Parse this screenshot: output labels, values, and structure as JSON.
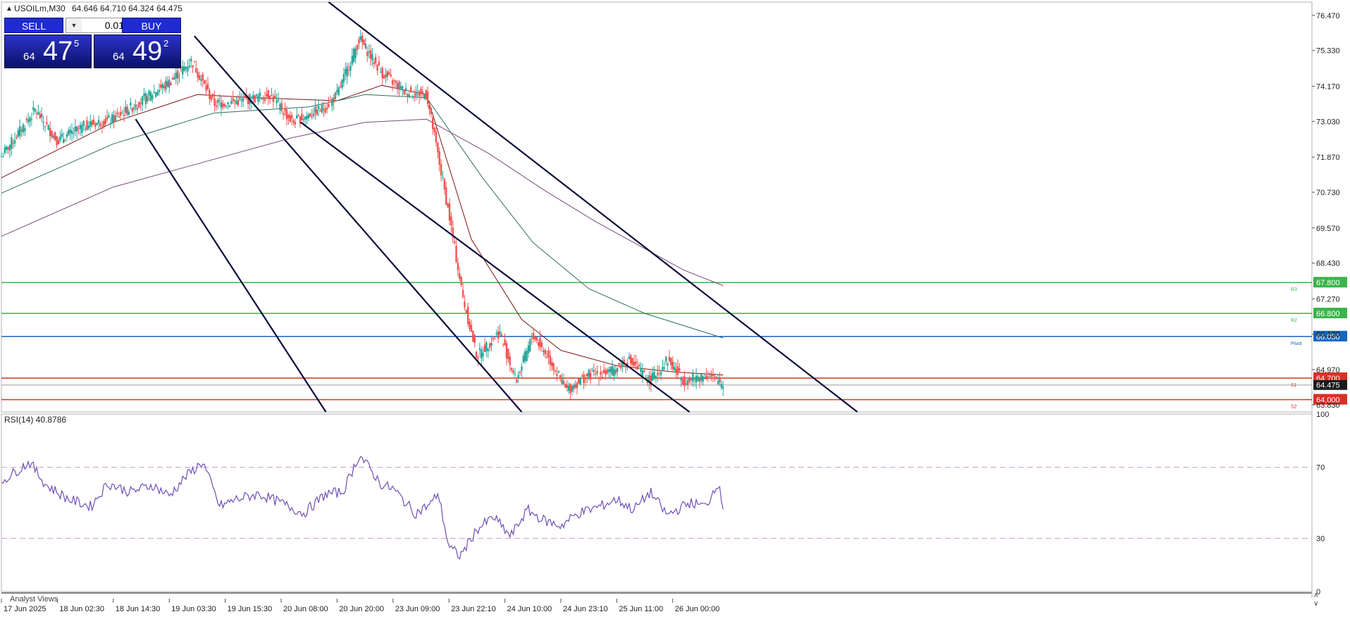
{
  "header": {
    "symbol": "USOILm,M30",
    "ohlc": "64.646 64.710 64.324 64.475"
  },
  "one_click": {
    "sell_label": "SELL",
    "buy_label": "BUY",
    "volume": "0.01",
    "sell_price": {
      "prefix": "64",
      "big": "47",
      "sup": "5"
    },
    "buy_price": {
      "prefix": "64",
      "big": "49",
      "sup": "2"
    }
  },
  "price_axis": {
    "ticks": [
      "76.470",
      "75.330",
      "74.170",
      "73.030",
      "71.870",
      "70.730",
      "69.570",
      "68.430",
      "67.270",
      "66.120",
      "64.970",
      "63.830"
    ],
    "last_price": "64.475"
  },
  "levels": [
    {
      "label": "R3",
      "price": "67.800",
      "value": 67.8,
      "color": "#3cb44b"
    },
    {
      "label": "R2",
      "price": "66.800",
      "value": 66.8,
      "color": "#3cb44b"
    },
    {
      "label": "Pivot",
      "price": "66.050",
      "value": 66.05,
      "color": "#1565c0"
    },
    {
      "label": "S1",
      "price": "64.700",
      "value": 64.7,
      "color": "#d93025"
    },
    {
      "label": "S2",
      "price": "64.000",
      "value": 64.0,
      "color": "#d93025"
    }
  ],
  "rsi": {
    "label": "RSI(14) 40.8786",
    "ticks": [
      "100",
      "70",
      "30",
      "0"
    ]
  },
  "time_axis": [
    "17 Jun 2025",
    "18 Jun 02:30",
    "18 Jun 14:30",
    "19 Jun 03:30",
    "19 Jun 15:30",
    "20 Jun 08:00",
    "20 Jun 20:00",
    "23 Jun 09:00",
    "23 Jun 22:10",
    "24 Jun 10:00",
    "24 Jun 23:10",
    "25 Jun 11:00",
    "26 Jun 00:00"
  ],
  "footer": {
    "analyst_views": "Analyst Views"
  },
  "colors": {
    "bull": "#26a69a",
    "bear": "#ef5350",
    "channel": "#0b0b3b",
    "rsi_line": "#6f4fb5",
    "ma_fast": "#7b1616",
    "ma_mid": "#2f6f5e",
    "ma_slow": "#7a4a7a"
  },
  "chart_data": {
    "type": "candlestick",
    "symbol": "USOILm",
    "timeframe": "M30",
    "ohlc_last": {
      "open": 64.646,
      "high": 64.71,
      "low": 64.324,
      "close": 64.475
    },
    "ylim": [
      63.6,
      76.9
    ],
    "close_path": [
      [
        0,
        71.9
      ],
      [
        0.6,
        73.4
      ],
      [
        1.0,
        72.4
      ],
      [
        1.5,
        72.9
      ],
      [
        2.0,
        73.1
      ],
      [
        2.5,
        73.7
      ],
      [
        3.0,
        74.3
      ],
      [
        3.4,
        75.0
      ],
      [
        3.8,
        73.6
      ],
      [
        4.3,
        73.7
      ],
      [
        4.8,
        73.9
      ],
      [
        5.2,
        73.0
      ],
      [
        5.8,
        73.5
      ],
      [
        6.0,
        73.9
      ],
      [
        6.4,
        75.7
      ],
      [
        6.8,
        74.6
      ],
      [
        7.2,
        74.0
      ],
      [
        7.6,
        73.9
      ],
      [
        8.0,
        70.0
      ],
      [
        8.25,
        67.3
      ],
      [
        8.5,
        65.4
      ],
      [
        8.9,
        66.2
      ],
      [
        9.2,
        64.6
      ],
      [
        9.5,
        66.1
      ],
      [
        9.8,
        65.3
      ],
      [
        10.1,
        64.3
      ],
      [
        10.5,
        64.8
      ],
      [
        10.9,
        64.9
      ],
      [
        11.2,
        65.3
      ],
      [
        11.6,
        64.6
      ],
      [
        11.9,
        65.3
      ],
      [
        12.2,
        64.6
      ],
      [
        12.6,
        64.8
      ],
      [
        12.9,
        64.5
      ]
    ],
    "rsi_path": [
      [
        0,
        62
      ],
      [
        0.5,
        73
      ],
      [
        0.8,
        60
      ],
      [
        1.2,
        52
      ],
      [
        1.6,
        48
      ],
      [
        1.9,
        61
      ],
      [
        2.3,
        56
      ],
      [
        2.7,
        60
      ],
      [
        3.0,
        54
      ],
      [
        3.3,
        65
      ],
      [
        3.6,
        73
      ],
      [
        3.9,
        48
      ],
      [
        4.2,
        52
      ],
      [
        4.6,
        55
      ],
      [
        5.0,
        50
      ],
      [
        5.4,
        44
      ],
      [
        5.8,
        55
      ],
      [
        6.1,
        56
      ],
      [
        6.4,
        77
      ],
      [
        6.8,
        60
      ],
      [
        7.0,
        58
      ],
      [
        7.4,
        44
      ],
      [
        7.7,
        50
      ],
      [
        7.8,
        56
      ],
      [
        8.0,
        25
      ],
      [
        8.2,
        20
      ],
      [
        8.5,
        35
      ],
      [
        8.8,
        42
      ],
      [
        9.1,
        31
      ],
      [
        9.4,
        46
      ],
      [
        9.7,
        40
      ],
      [
        10.0,
        37
      ],
      [
        10.3,
        44
      ],
      [
        10.7,
        48
      ],
      [
        11.0,
        52
      ],
      [
        11.3,
        46
      ],
      [
        11.6,
        56
      ],
      [
        11.9,
        43
      ],
      [
        12.3,
        50
      ],
      [
        12.6,
        48
      ],
      [
        12.8,
        62
      ],
      [
        12.95,
        41
      ]
    ],
    "ma_fast": [
      [
        0,
        71.2
      ],
      [
        2.0,
        73.0
      ],
      [
        3.5,
        73.9
      ],
      [
        4.5,
        73.8
      ],
      [
        6.0,
        73.7
      ],
      [
        6.8,
        74.2
      ],
      [
        7.6,
        73.9
      ],
      [
        8.4,
        69.2
      ],
      [
        9.3,
        66.6
      ],
      [
        10.0,
        65.6
      ],
      [
        11.0,
        65.1
      ],
      [
        12.0,
        64.9
      ],
      [
        12.9,
        64.8
      ]
    ],
    "ma_mid": [
      [
        0,
        70.7
      ],
      [
        2.0,
        72.3
      ],
      [
        3.8,
        73.3
      ],
      [
        5.5,
        73.5
      ],
      [
        6.5,
        73.9
      ],
      [
        7.6,
        73.8
      ],
      [
        8.6,
        71.2
      ],
      [
        9.5,
        69.1
      ],
      [
        10.5,
        67.6
      ],
      [
        11.5,
        66.8
      ],
      [
        12.9,
        66.0
      ]
    ],
    "ma_slow": [
      [
        0,
        69.3
      ],
      [
        2.0,
        70.9
      ],
      [
        3.8,
        71.8
      ],
      [
        5.2,
        72.5
      ],
      [
        6.5,
        73.0
      ],
      [
        7.6,
        73.1
      ],
      [
        8.7,
        72.0
      ],
      [
        9.7,
        70.8
      ],
      [
        10.6,
        69.8
      ],
      [
        11.5,
        68.9
      ],
      [
        12.2,
        68.2
      ],
      [
        12.9,
        67.7
      ]
    ],
    "channels": [
      {
        "from": [
          3.45,
          75.8
        ],
        "to": [
          9.3,
          63.6
        ]
      },
      {
        "from": [
          5.35,
          73.0
        ],
        "to": [
          12.3,
          63.6
        ]
      },
      {
        "from": [
          2.4,
          73.1
        ],
        "to": [
          5.8,
          63.6
        ]
      },
      {
        "from": [
          5.85,
          76.9
        ],
        "to": [
          15.3,
          63.6
        ]
      }
    ]
  }
}
